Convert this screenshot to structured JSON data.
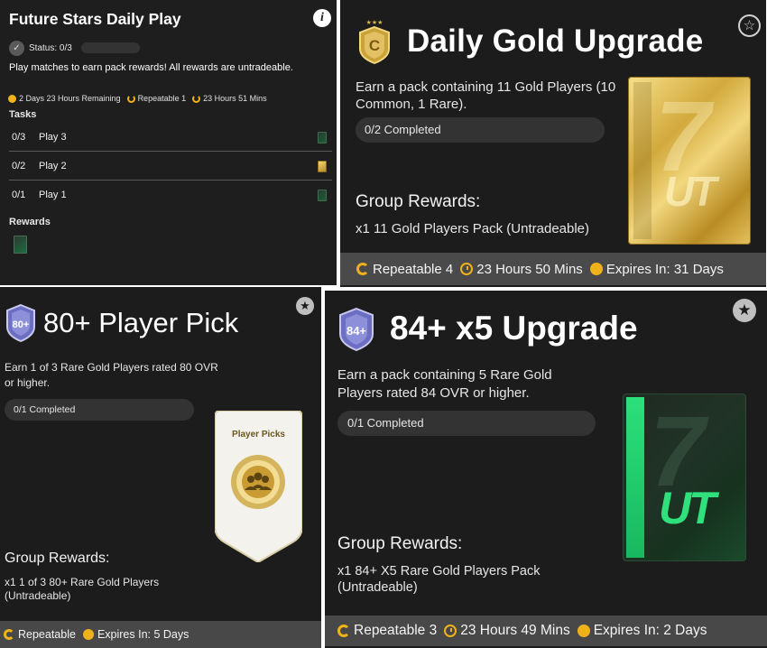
{
  "panel1": {
    "title": "Future Stars Daily Play",
    "status": "Status: 0/3",
    "description": "Play matches to earn pack rewards! All rewards are untradeable.",
    "time_remaining": "2 Days 23 Hours Remaining",
    "repeatable": "Repeatable 1",
    "refresh": "23 Hours 51 Mins",
    "tasks_label": "Tasks",
    "tasks": [
      {
        "progress": "0/3",
        "name": "Play 3",
        "pack": "green"
      },
      {
        "progress": "0/2",
        "name": "Play 2",
        "pack": "gold"
      },
      {
        "progress": "0/1",
        "name": "Play 1",
        "pack": "green"
      }
    ],
    "rewards_label": "Rewards"
  },
  "panel2": {
    "title": "Daily Gold Upgrade",
    "description": "Earn a pack containing 11 Gold Players (10 Common, 1 Rare).",
    "progress": "0/2 Completed",
    "group_rewards_title": "Group Rewards:",
    "group_rewards": "x1 11 Gold Players Pack (Untradeable)",
    "footer": {
      "repeatable": "Repeatable 4",
      "refresh": "23 Hours 50 Mins",
      "expires": "Expires In: 31 Days"
    }
  },
  "panel3": {
    "title": "80+ Player Pick",
    "badge_text": "80+",
    "description": "Earn 1 of 3 Rare Gold Players rated 80 OVR or higher.",
    "progress": "0/1 Completed",
    "pick_label": "Player Picks",
    "group_rewards_title": "Group Rewards:",
    "group_rewards": "x1 1 of 3 80+ Rare Gold Players (Untradeable)",
    "footer": {
      "repeatable": "Repeatable",
      "expires": "Expires In: 5 Days"
    }
  },
  "panel4": {
    "title": "84+ x5 Upgrade",
    "badge_text": "84+",
    "description": "Earn a pack containing 5 Rare Gold Players rated 84 OVR or higher.",
    "progress": "0/1 Completed",
    "group_rewards_title": "Group Rewards:",
    "group_rewards": "x1 84+ X5 Rare Gold Players Pack (Untradeable)",
    "footer": {
      "repeatable": "Repeatable 3",
      "refresh": "23 Hours 49 Mins",
      "expires": "Expires In: 2 Days"
    }
  },
  "pack_logo": "UT",
  "colors": {
    "accent": "#f0b21a",
    "panel_bg": "#1c1c1c",
    "footer_bg": "#4a4a4a",
    "pill_bg": "#333333"
  }
}
